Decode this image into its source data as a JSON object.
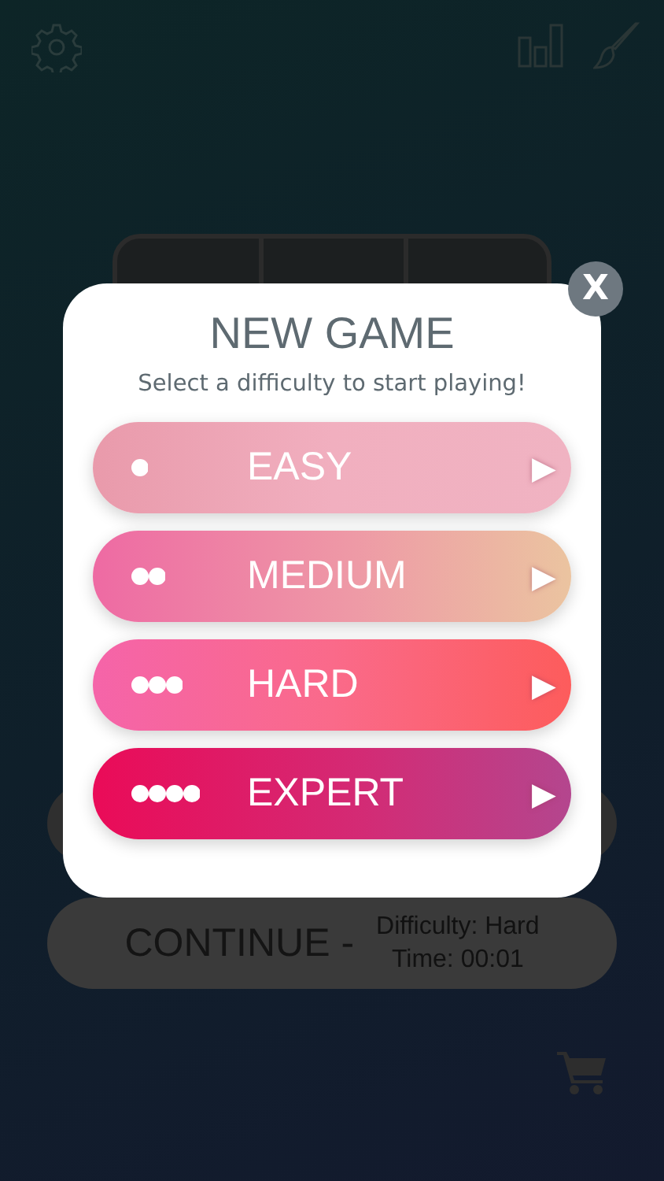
{
  "modal": {
    "title": "NEW GAME",
    "subtitle": "Select a difficulty to start playing!",
    "close": "X",
    "options": [
      {
        "kind": "easy",
        "label": "EASY",
        "arrow": "▶"
      },
      {
        "kind": "medium",
        "label": "MEDIUM",
        "arrow": "▶"
      },
      {
        "kind": "hard",
        "label": "HARD",
        "arrow": "▶"
      },
      {
        "kind": "expert",
        "label": "EXPERT",
        "arrow": "▶"
      }
    ]
  },
  "continue_button": {
    "label": "CONTINUE -",
    "difficulty": "Difficulty: Hard",
    "time": "Time: 00:01"
  }
}
